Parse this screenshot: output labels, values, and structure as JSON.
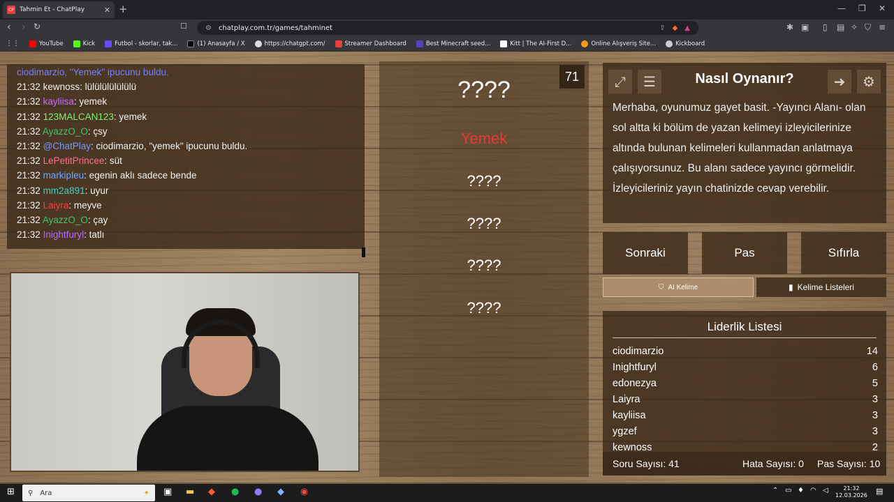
{
  "browser": {
    "tab_title": "Tahmin Et - ChatPlay",
    "tab_favicon": "CP",
    "url": "chatplay.com.tr/games/tahminet",
    "bookmarks": [
      {
        "label": "YouTube",
        "color": "#ff0000"
      },
      {
        "label": "Kick",
        "color": "#53fc18"
      },
      {
        "label": "Futbol - skorlar, tak...",
        "color": "#6a4cff"
      },
      {
        "label": "(1) Anasayfa / X",
        "color": "#ffffff"
      },
      {
        "label": "https://chatgpt.com/",
        "color": "#ffffff"
      },
      {
        "label": "Streamer Dashboard",
        "color": "#e83e3e"
      },
      {
        "label": "Best Minecraft seed...",
        "color": "#5a3fbf"
      },
      {
        "label": "Kitt | The AI-First D...",
        "color": "#ffffff"
      },
      {
        "label": "Online Alışveriş Site...",
        "color": "#f39c12"
      },
      {
        "label": "Kickboard",
        "color": "#cccccc"
      }
    ]
  },
  "chat": {
    "lines": [
      {
        "ts": "",
        "user": "ciodimarzio, ",
        "user_color": "#6f82ff",
        "msg": "\"Yemek\" ipucunu buldu.",
        "msg_color": "#6f82ff"
      },
      {
        "ts": "21:32",
        "user": "kewnoss",
        "user_color": "#f2f2f2",
        "msg": ": lülülülülülülü",
        "msg_color": "#f2f2f2"
      },
      {
        "ts": "21:32",
        "user": "kayliisa",
        "user_color": "#c56bff",
        "msg": ": yemek",
        "msg_color": "#f2f2f2"
      },
      {
        "ts": "21:32",
        "user": "123MALCAN123",
        "user_color": "#7cf06a",
        "msg": ": yemek",
        "msg_color": "#f2f2f2"
      },
      {
        "ts": "21:32",
        "user": "AyazzO_O",
        "user_color": "#46c46a",
        "msg": ": çsy",
        "msg_color": "#f2f2f2"
      },
      {
        "ts": "21:32",
        "user": "@ChatPlay",
        "user_color": "#6f9cff",
        "msg": ": ciodimarzio, \"yemek\" ipucunu buldu.",
        "msg_color": "#f2f2f2"
      },
      {
        "ts": "21:32",
        "user": "LePetitPrincee",
        "user_color": "#ff6f91",
        "msg": ": süt",
        "msg_color": "#f2f2f2"
      },
      {
        "ts": "21:32",
        "user": "markipleu",
        "user_color": "#6fa8ff",
        "msg": ": egenin aklı sadece bende",
        "msg_color": "#f2f2f2"
      },
      {
        "ts": "21:32",
        "user": "mm2a891",
        "user_color": "#46d0c0",
        "msg": ": uyur",
        "msg_color": "#f2f2f2"
      },
      {
        "ts": "21:32",
        "user": "Laiyra",
        "user_color": "#ff3b3b",
        "msg": ": meyve",
        "msg_color": "#f2f2f2"
      },
      {
        "ts": "21:32",
        "user": "AyazzO_O",
        "user_color": "#46c46a",
        "msg": ": çay",
        "msg_color": "#f2f2f2"
      },
      {
        "ts": "21:32",
        "user": "Inightfuryl",
        "user_color": "#b36bff",
        "msg": ": tatlı",
        "msg_color": "#f2f2f2"
      }
    ]
  },
  "game": {
    "counter": "71",
    "main_word": "????",
    "found_word": "Yemek",
    "found_color": "#e53935",
    "hidden_words": [
      "????",
      "????",
      "????",
      "????"
    ]
  },
  "howto": {
    "title": "Nasıl Oynanır?",
    "text": "Merhaba, oyunumuz gayet basit. -Yayıncı Alanı- olan sol altta ki bölüm de yazan kelimeyi izleyicilerinize altında bulunan kelimeleri kullanmadan anlatmaya çalışıyorsunuz. Bu alanı sadece yayıncı görmelidir. İzleyicileriniz yayın chatinizde cevap verebilir."
  },
  "buttons": {
    "next": "Sonraki",
    "pass": "Pas",
    "reset": "Sıfırla",
    "ai_word": "AI Kelime",
    "word_lists": "Kelime Listeleri"
  },
  "leaderboard": {
    "title": "Liderlik Listesi",
    "rows": [
      {
        "name": "ciodimarzio",
        "score": "14"
      },
      {
        "name": "Inightfuryl",
        "score": "6"
      },
      {
        "name": "edonezya",
        "score": "5"
      },
      {
        "name": "Laiyra",
        "score": "3"
      },
      {
        "name": "kayliisa",
        "score": "3"
      },
      {
        "name": "ygzef",
        "score": "3"
      },
      {
        "name": "kewnoss",
        "score": "2"
      }
    ],
    "question_count": "Soru Sayısı: 41",
    "error_count": "Hata Sayısı: 0",
    "pass_count": "Pas Sayısı: 10"
  },
  "taskbar": {
    "search_placeholder": "Ara",
    "time": "21:32",
    "date": "12.03.2026"
  }
}
